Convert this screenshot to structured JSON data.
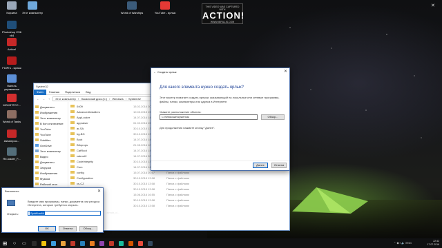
{
  "desktop": {
    "icons": [
      {
        "label": "Корзина",
        "color": "#9aa7b8"
      },
      {
        "label": "Этот компьютер",
        "color": "#6fa8dc"
      },
      {
        "label": "World of Warships",
        "color": "#3b5b7a"
      },
      {
        "label": "YouTube - ярлык",
        "color": "#e53935"
      },
      {
        "label": "Photoshop CS6 x64",
        "color": "#1f4e79"
      },
      {
        "label": "Action!",
        "color": "#c62828"
      },
      {
        "label": "FiniPro - ярлык",
        "color": "#b71c1c"
      },
      {
        "label": "Панель управления",
        "color": "#5c8fd6"
      },
      {
        "label": "100HS7FCC...",
        "color": "#d32f2f"
      },
      {
        "label": "World of Tanks",
        "color": "#8d6e63"
      },
      {
        "label": "Ashampoo...",
        "color": "#c62828"
      },
      {
        "label": "Re-loader_F...",
        "color": "#546e7a"
      }
    ]
  },
  "watermark": {
    "top": "THIS VIDEO WAS CAPTURED WITH",
    "brand": "ACTION!",
    "bottom": "WWW.MIRILLIS.COM"
  },
  "explorer": {
    "title": "System32",
    "ribbon_tabs": [
      "Файл",
      "Главная",
      "Поделиться",
      "Вид"
    ],
    "path": [
      "Этот компьютер",
      "Локальный диск (C:)",
      "Windows",
      "System32"
    ],
    "nav": [
      "Документы",
      "Изображения",
      "Этот компьютер",
      "В Кон отключение",
      "YouTube",
      "YouTube",
      "Subtitles",
      "OneDrive",
      "Этот компьютер",
      "Видео",
      "Документы",
      "Загрузки",
      "Изображения",
      "Музыка",
      "Рабочий стол"
    ],
    "rows": [
      {
        "name": "0409",
        "date": "15.02.2016 20:34",
        "type": "Папка с файлами"
      },
      {
        "name": "AdvancedInstallers",
        "date": "10.03.2015 15:07",
        "type": "Папка с файлами"
      },
      {
        "name": "AppLocker",
        "date": "14.07.2016 14:46",
        "type": "Папка с файлами"
      },
      {
        "name": "appraiser",
        "date": "01.02.2016 15:20",
        "type": "Папка с файлами"
      },
      {
        "name": "ar-SA",
        "date": "30.10.2015 13:08",
        "type": "Папка с файлами"
      },
      {
        "name": "bg-BG",
        "date": "30.10.2015 13:08",
        "type": "Папка с файлами"
      },
      {
        "name": "Boot",
        "date": "14.07.2016 14:46",
        "type": "Папка с файлами"
      },
      {
        "name": "Bthprops",
        "date": "21.05.2016 10:27",
        "type": "Папка с файлами"
      },
      {
        "name": "CatRoot",
        "date": "14.07.2016 14:46",
        "type": "Папка с файлами"
      },
      {
        "name": "catroot2",
        "date": "14.07.2016 20:21",
        "type": "Папка с файлами"
      },
      {
        "name": "CodeIntegrity",
        "date": "30.10.2015 13:08",
        "type": "Папка с файлами"
      },
      {
        "name": "Com",
        "date": "14.07.2016 14:46",
        "type": "Папка с файлами"
      },
      {
        "name": "config",
        "date": "15.07.2016 20:07",
        "type": "Папка с файлами"
      },
      {
        "name": "Configuration",
        "date": "30.10.2015 13:08",
        "type": "Папка с файлами"
      },
      {
        "name": "cs-CZ",
        "date": "30.10.2015 13:08",
        "type": "Папка с файлами"
      },
      {
        "name": "da-DK",
        "date": "30.10.2015 13:08",
        "type": "Папка с файлами"
      },
      {
        "name": "DDFs",
        "date": "15.06.2016 16:55",
        "type": "Папка с файлами"
      },
      {
        "name": "de-DE",
        "date": "30.10.2015 13:08",
        "type": "Папка с файлами"
      },
      {
        "name": "DiagSvcs",
        "date": "30.10.2015 13:08",
        "type": "Папка с файлами"
      }
    ],
    "status": "Элементов: 4 120"
  },
  "wizard": {
    "title": "Создать ярлык",
    "heading": "Для какого элемента нужно создать ярлык?",
    "description": "Этот мастер помогает создать ярлыки, указывающий на локальные или сетевые программы, файлы, папки, компьютеры или адреса в Интернете.",
    "location_label": "Укажите расположение объекта:",
    "location_value": "C:\\Windows\\System32",
    "browse_label": "Обзор...",
    "hint": "Для продолжения нажмите кнопку \"Далее\".",
    "next_label": "Далее",
    "cancel_label": "Отмена"
  },
  "run": {
    "title": "Выполнить",
    "description": "Введите имя программы, папки, документа или ресурса Интернета, которые требуется открыть.",
    "open_label": "Открыть:",
    "input_value": "SysWow64",
    "ok_label": "OK",
    "cancel_label": "Отмена",
    "browse_label": "Обзор..."
  },
  "taskbar": {
    "apps": [
      "#2b2b2b",
      "#f1c40f",
      "#3b9ddd",
      "#e8a33d",
      "#c0392b",
      "#2980b9",
      "#e67e22",
      "#8e44ad",
      "#c0392b",
      "#1abc9c",
      "#d35400",
      "#e74c3c",
      "#34495e"
    ],
    "extra_label": "catmob_d...",
    "lang": "ENG",
    "time": "22:42",
    "date": "17.07.2016"
  }
}
